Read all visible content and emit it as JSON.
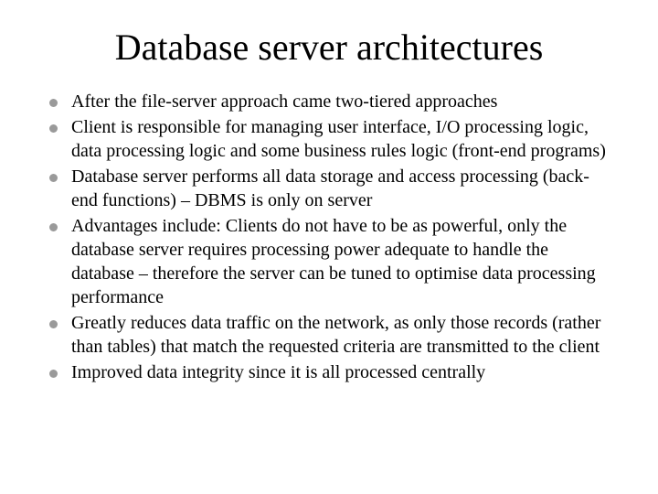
{
  "title": "Database server architectures",
  "bullets": [
    "After the file-server approach came two-tiered approaches",
    "Client is responsible for managing user interface, I/O processing logic, data processing logic and some business rules logic (front-end programs)",
    "Database server performs all data storage and access processing (back-end functions) – DBMS is only on server",
    "Advantages include: Clients do not have to be as powerful, only the database server requires processing power adequate to handle the database – therefore the server can be tuned to optimise data processing performance",
    "Greatly reduces data traffic on the network, as only those records (rather than tables) that match the requested criteria are transmitted to the client",
    "Improved data integrity since it is all processed centrally"
  ]
}
